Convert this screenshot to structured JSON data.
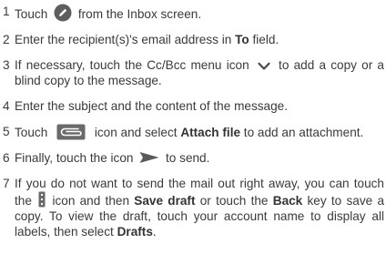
{
  "colors": {
    "text": "#3a3a3a",
    "icon_gray": "#5e5e5e"
  },
  "steps": [
    {
      "num": "1",
      "a": "Touch",
      "icon": "compose-pencil-icon",
      "b": "from the Inbox screen."
    },
    {
      "num": "2",
      "a": "Enter the recipient(s)'s email address in ",
      "bold": "To",
      "b": " field."
    },
    {
      "num": "3",
      "a": "If necessary, touch the Cc/Bcc menu icon",
      "icon": "chevron-down-icon",
      "b": "to add a copy or a blind copy to the message."
    },
    {
      "num": "4",
      "a": "Enter the subject and the content of the message."
    },
    {
      "num": "5",
      "a": "Touch",
      "icon": "paperclip-icon",
      "b": "icon and select ",
      "bold": "Attach file",
      "c": " to add an attachment."
    },
    {
      "num": "6",
      "a": "Finally, touch the icon",
      "icon": "send-arrow-icon",
      "b": "to send."
    },
    {
      "num": "7",
      "a": "If you do not want to send the mail out right away, you can touch the",
      "icon": "overflow-menu-icon",
      "b": "icon and then ",
      "bold1": "Save draft",
      "c": " or touch the ",
      "bold2": "Back",
      "d": " key to save a copy. To view the draft, touch your account name to display all labels, then select ",
      "bold3": "Drafts",
      "e": "."
    }
  ]
}
